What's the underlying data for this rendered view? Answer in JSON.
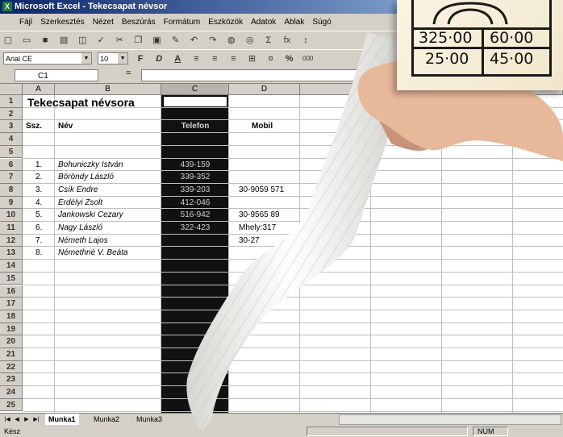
{
  "window": {
    "title": "Microsoft Excel - Tekecsapat névsor"
  },
  "menu": [
    "Fájl",
    "Szerkesztés",
    "Nézet",
    "Beszúrás",
    "Formátum",
    "Eszközök",
    "Adatok",
    "Ablak",
    "Súgó"
  ],
  "toolbar": {
    "font_name": "Arial CE",
    "font_size": "10",
    "bold": "F",
    "italic": "D",
    "underline": "A",
    "percent": "%",
    "thousands": "000",
    "sum": "Σ",
    "fx": "fx"
  },
  "formula_bar": {
    "name_box": "C1",
    "equals": "="
  },
  "columns": [
    "A",
    "B",
    "C",
    "D"
  ],
  "rows": [
    "1",
    "2",
    "3",
    "4",
    "5",
    "6",
    "7",
    "8",
    "9",
    "10",
    "11",
    "12",
    "13",
    "14",
    "15",
    "16",
    "17",
    "18",
    "19",
    "20",
    "21",
    "22",
    "23",
    "24",
    "25"
  ],
  "sheet": {
    "title": "Tekecsapat névsora",
    "headers": {
      "num": "Ssz.",
      "name": "Név",
      "phone": "Telefon",
      "mobile": "Mobil"
    },
    "people": [
      {
        "num": "1.",
        "name": "Bohuniczky István",
        "phone": "439-159",
        "mobile": ""
      },
      {
        "num": "2.",
        "name": "Böröndy László",
        "phone": "339-352",
        "mobile": ""
      },
      {
        "num": "3.",
        "name": "Csík Endre",
        "phone": "339-203",
        "mobile": "30-9059 571"
      },
      {
        "num": "4.",
        "name": "Erdélyi Zsolt",
        "phone": "412-046",
        "mobile": ""
      },
      {
        "num": "5.",
        "name": "Jankowski Cezary",
        "phone": "516-942",
        "mobile": "30-9565 89"
      },
      {
        "num": "6.",
        "name": "Nagy László",
        "phone": "322-423",
        "mobile": "Mhely:317"
      },
      {
        "num": "7.",
        "name": "Németh Lajos",
        "phone": "",
        "mobile": "30-27"
      },
      {
        "num": "8.",
        "name": "Némethné V. Beáta",
        "phone": "",
        "mobile": ""
      }
    ]
  },
  "tabs": [
    "Munka1",
    "Munka2",
    "Munka3"
  ],
  "status": {
    "ready": "Kész",
    "num": "NUM"
  },
  "note": {
    "values": [
      "325·00",
      "60·00",
      "25·00",
      "45·00"
    ]
  }
}
